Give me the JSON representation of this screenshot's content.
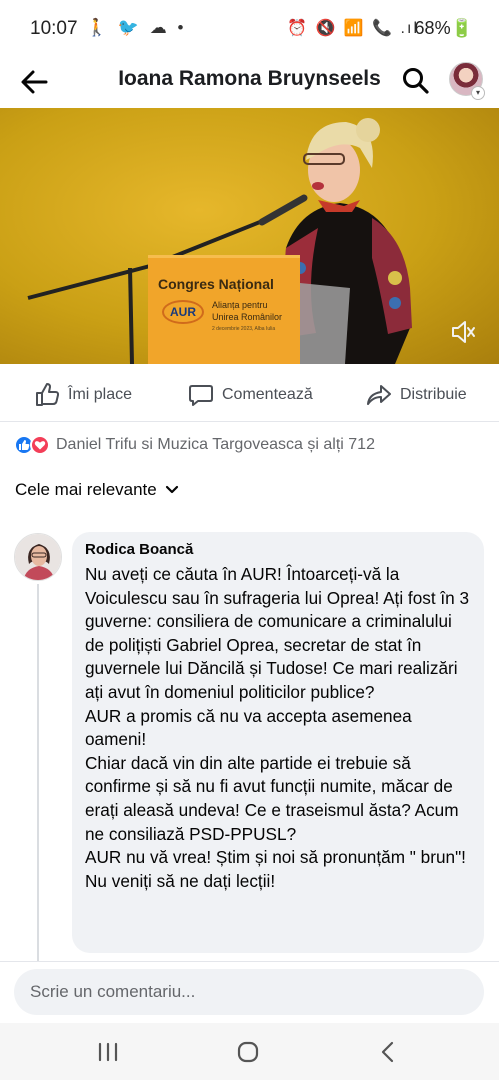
{
  "status_bar": {
    "time": "10:07",
    "left_icons": "🚶 🐦 ☁ •",
    "right_icons": "⏰ 🔇 📶 📞 .ıl",
    "battery": "68%🔋"
  },
  "header": {
    "title": "Ioana Ramona Bruynseels"
  },
  "video": {
    "podium_title": "Congres Național",
    "podium_logo": "AUR",
    "podium_sub1": "Alianța pentru",
    "podium_sub2": "Unirea Românilor",
    "podium_date": "2 decembrie 2023, Alba Iulia"
  },
  "actions": {
    "like": "Îmi place",
    "comment": "Comentează",
    "share": "Distribuie"
  },
  "reactions": {
    "text": "Daniel Trifu si Muzica Targoveasca și alți 712"
  },
  "sort": {
    "label": "Cele mai relevante"
  },
  "comment": {
    "author": "Rodica Boancă",
    "text": "Nu aveți ce căuta în AUR! Întoarceți-vă la Voiculescu sau în sufrageria lui Oprea! Ați fost în 3 guverne: consiliera de comunicare a criminalului de polițiști Gabriel Oprea, secretar de stat în guvernele lui Dăncilă și Tudose! Ce mari realizări ați avut în domeniul politicilor publice?\nAUR a promis că nu va accepta asemenea oameni!\nChiar dacă vin din alte partide ei trebuie să confirme și să nu fi avut funcții numite, măcar de erați aleasă undeva! Ce e traseismul ăsta? Acum ne consiliază PSD-PPUSL?\nAUR nu vă vrea! Știm și noi să pronunțăm \" brun\"! Nu veniți să ne dați lecții!"
  },
  "composer": {
    "placeholder": "Scrie un comentariu..."
  },
  "colors": {
    "accent": "#1877f2",
    "love": "#f33e58",
    "video_bg": "#d7a21a",
    "podium": "#f1a52a"
  }
}
